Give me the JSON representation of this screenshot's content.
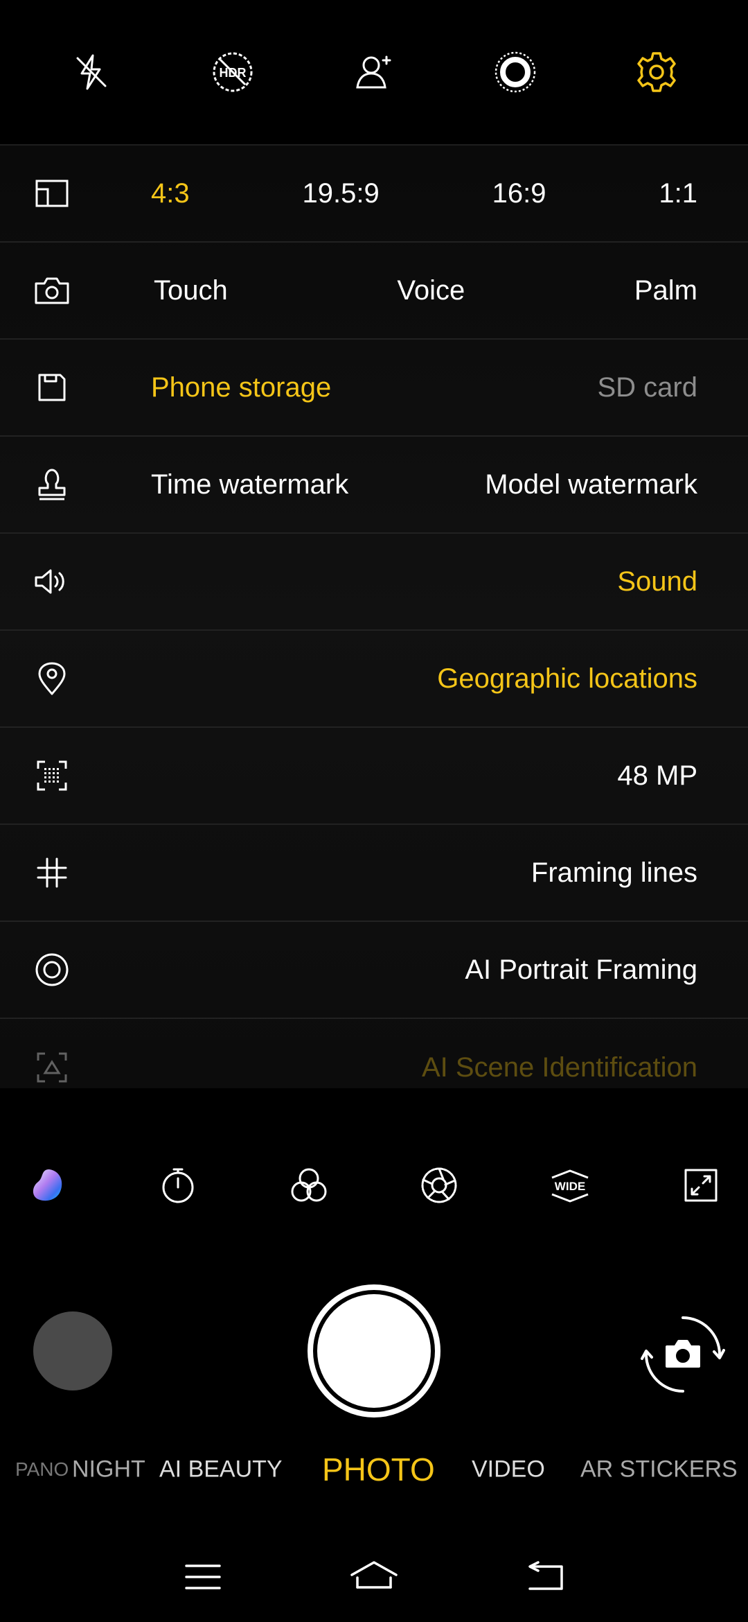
{
  "topbar": {
    "icons": [
      "flash-off-icon",
      "hdr-off-icon",
      "add-user-icon",
      "shutter-ring-icon",
      "gear-icon"
    ],
    "active_color": "#f5c518"
  },
  "settings": {
    "aspect": {
      "icon": "aspect-ratio-icon",
      "options": [
        "4:3",
        "19.5:9",
        "16:9",
        "1:1"
      ],
      "selected": "4:3"
    },
    "capture": {
      "icon": "camera-icon",
      "options": [
        "Touch",
        "Voice",
        "Palm"
      ]
    },
    "storage": {
      "icon": "save-icon",
      "options": [
        "Phone storage",
        "SD card"
      ],
      "selected": "Phone storage"
    },
    "watermark": {
      "icon": "stamp-icon",
      "options": [
        "Time watermark",
        "Model watermark"
      ]
    },
    "sound": {
      "icon": "speaker-icon",
      "label": "Sound"
    },
    "location": {
      "icon": "location-pin-icon",
      "label": "Geographic locations"
    },
    "resolution": {
      "icon": "megapixel-icon",
      "label": "48 MP"
    },
    "framing": {
      "icon": "grid-icon",
      "label": "Framing lines"
    },
    "portrait": {
      "icon": "target-icon",
      "label": "AI Portrait Framing"
    },
    "scene": {
      "icon": "scene-icon",
      "label": "AI Scene Identification"
    }
  },
  "tools": [
    "color-blob-icon",
    "timer-icon",
    "filters-icon",
    "aperture-icon",
    "wide-angle-icon",
    "expand-icon"
  ],
  "modes": {
    "items": [
      "PANO",
      "NIGHT",
      "AI BEAUTY",
      "PHOTO",
      "VIDEO",
      "AR STICKERS"
    ],
    "selected": "PHOTO"
  },
  "navbar": [
    "menu-icon",
    "home-icon",
    "back-icon"
  ],
  "colors": {
    "accent": "#f5c518",
    "background": "#000000",
    "divider": "#222222"
  }
}
